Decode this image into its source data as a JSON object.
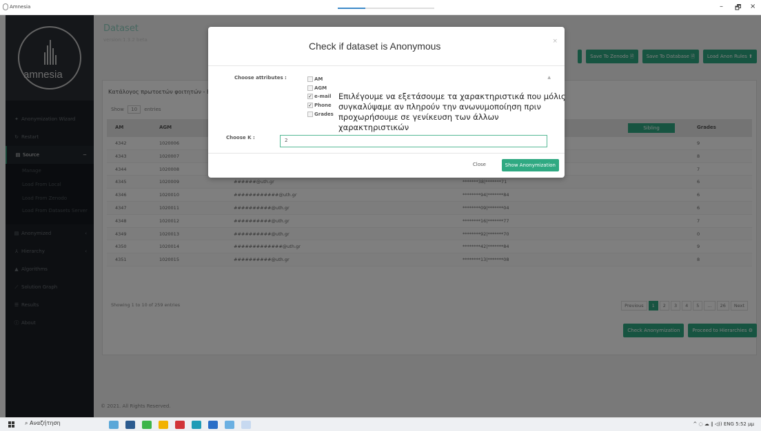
{
  "window": {
    "title": "Amnesia",
    "minimize": "–",
    "maximize": "🗗",
    "close": "×"
  },
  "sidebar": {
    "brand": "amnesia",
    "items": [
      {
        "label": "Anonymization Wizard",
        "icon": "wand-icon"
      },
      {
        "label": "Restart",
        "icon": "restart-icon"
      },
      {
        "label": "Source",
        "icon": "source-icon",
        "chevron": "−"
      },
      {
        "label": "Anonymized",
        "icon": "anonymized-icon",
        "chevron": "‹"
      },
      {
        "label": "Hierarchy",
        "icon": "hierarchy-icon",
        "chevron": "‹"
      },
      {
        "label": "Algorithms",
        "icon": "algorithms-icon"
      },
      {
        "label": "Solution Graph",
        "icon": "graph-icon"
      },
      {
        "label": "Results",
        "icon": "results-icon"
      },
      {
        "label": "About",
        "icon": "info-icon"
      }
    ],
    "source_sub": [
      "Manage",
      "Load From Local",
      "Load From Zenodo",
      "Load From Datasets Server"
    ]
  },
  "header": {
    "title": "Dataset",
    "version": "version:1.3.2 beta"
  },
  "top_buttons": [
    "",
    "Save To Zenodo 🗎",
    "Save To Database 🗎",
    "Load Anon Rules ⬆"
  ],
  "panel": {
    "title": "Κατάλογος πρωτοετών φοιτητών - Bi",
    "show_prefix": "Show",
    "show_value": "10",
    "show_suffix": "entries",
    "columns": [
      "AM",
      "AGM",
      "",
      "",
      "Grades"
    ],
    "sort_button": "Sibling",
    "rows": [
      {
        "am": "4342",
        "agm": "1020006",
        "email": "",
        "phone": "",
        "grade": "9"
      },
      {
        "am": "4343",
        "agm": "1020007",
        "email": "",
        "phone": "",
        "grade": "8"
      },
      {
        "am": "4344",
        "agm": "1020008",
        "email": "",
        "phone": "",
        "grade": "7"
      },
      {
        "am": "4345",
        "agm": "1020009",
        "email": "######@uth.gr",
        "phone": "*******38|*******71",
        "grade": "6"
      },
      {
        "am": "4346",
        "agm": "1020010",
        "email": "############@uth.gr",
        "phone": "********94|*******84",
        "grade": "6"
      },
      {
        "am": "4347",
        "agm": "1020011",
        "email": "##########@uth.gr",
        "phone": "********09|*******04",
        "grade": "6"
      },
      {
        "am": "4348",
        "agm": "1020012",
        "email": "##########@uth.gr",
        "phone": "********16|*******77",
        "grade": "7"
      },
      {
        "am": "4349",
        "agm": "1020013",
        "email": "##########@uth.gr",
        "phone": "********92|*******70",
        "grade": "0"
      },
      {
        "am": "4350",
        "agm": "1020014",
        "email": "#############@uth.gr",
        "phone": "********42|*******84",
        "grade": "9"
      },
      {
        "am": "4351",
        "agm": "1020015",
        "email": "##########@uth.gr",
        "phone": "********13|*******08",
        "grade": "8"
      }
    ],
    "showing": "Showing 1 to 10 of 259 entries",
    "pager": [
      "Previous",
      "1",
      "2",
      "3",
      "4",
      "5",
      "...",
      "26",
      "Next"
    ]
  },
  "bottom_buttons": [
    "Check Anonymization",
    "Proceed to Hierarchies ⚙"
  ],
  "footer": "© 2021. All Rights Reserved.",
  "modal": {
    "title": "Check if dataset is Anonymous",
    "close_x": "×",
    "attributes_label": "Choose attributes :",
    "attributes": [
      {
        "name": "AM",
        "checked": false
      },
      {
        "name": "AGM",
        "checked": false
      },
      {
        "name": "e-mail",
        "checked": true
      },
      {
        "name": "Phone",
        "checked": true
      },
      {
        "name": "Grades",
        "checked": false
      }
    ],
    "note": "Επιλέγουμε να εξετάσουμε τα χαρακτηριστικά που μόλις συγκαλύψαμε αν πληρούν την ανωνυμοποίηση πριν προχωρήσουμε σε γενίκευση των άλλων χαρακτηριστικών",
    "k_label": "Choose K :",
    "k_value": "2",
    "close_label": "Close",
    "show_label": "Show Anonymization"
  },
  "taskbar": {
    "search": "Αναζήτηση",
    "tray": "^ ◌ ☁ ∥ ◁)) ENG  5:52 μμ"
  },
  "colors": {
    "accent": "#2fa982",
    "sidebar": "#1b1f25"
  }
}
